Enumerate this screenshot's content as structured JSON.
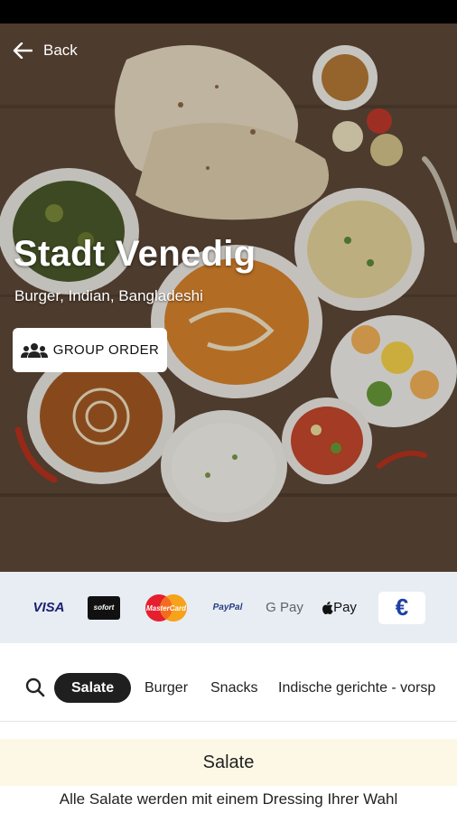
{
  "header": {
    "back_label": "Back",
    "restaurant_name": "Stadt Venedig",
    "cuisines": "Burger, Indian, Bangladeshi",
    "group_order_label": "GROUP ORDER"
  },
  "payment_methods": [
    {
      "icon": "visa-icon",
      "label": "VISA"
    },
    {
      "icon": "sofort-icon",
      "label": "sofort"
    },
    {
      "icon": "mastercard-icon",
      "label": "MasterCard"
    },
    {
      "icon": "paypal-icon",
      "label": "PayPal"
    },
    {
      "icon": "google-pay-icon",
      "label": "G Pay"
    },
    {
      "icon": "apple-pay-icon",
      "label": "Pay"
    },
    {
      "icon": "euro-cash-icon",
      "label": "€"
    }
  ],
  "category_tabs": {
    "items": [
      {
        "label": "Salate",
        "active": true
      },
      {
        "label": "Burger",
        "active": false
      },
      {
        "label": "Snacks",
        "active": false
      },
      {
        "label": "Indische gerichte - vorsp",
        "active": false
      }
    ]
  },
  "menu": {
    "section_title": "Salate",
    "section_description": "Alle Salate werden mit einem Dressing Ihrer Wahl"
  },
  "colors": {
    "active_tab_bg": "#1f1f1f",
    "section_header_bg": "#fdf8e6",
    "payment_strip_bg": "#e8edf3"
  }
}
